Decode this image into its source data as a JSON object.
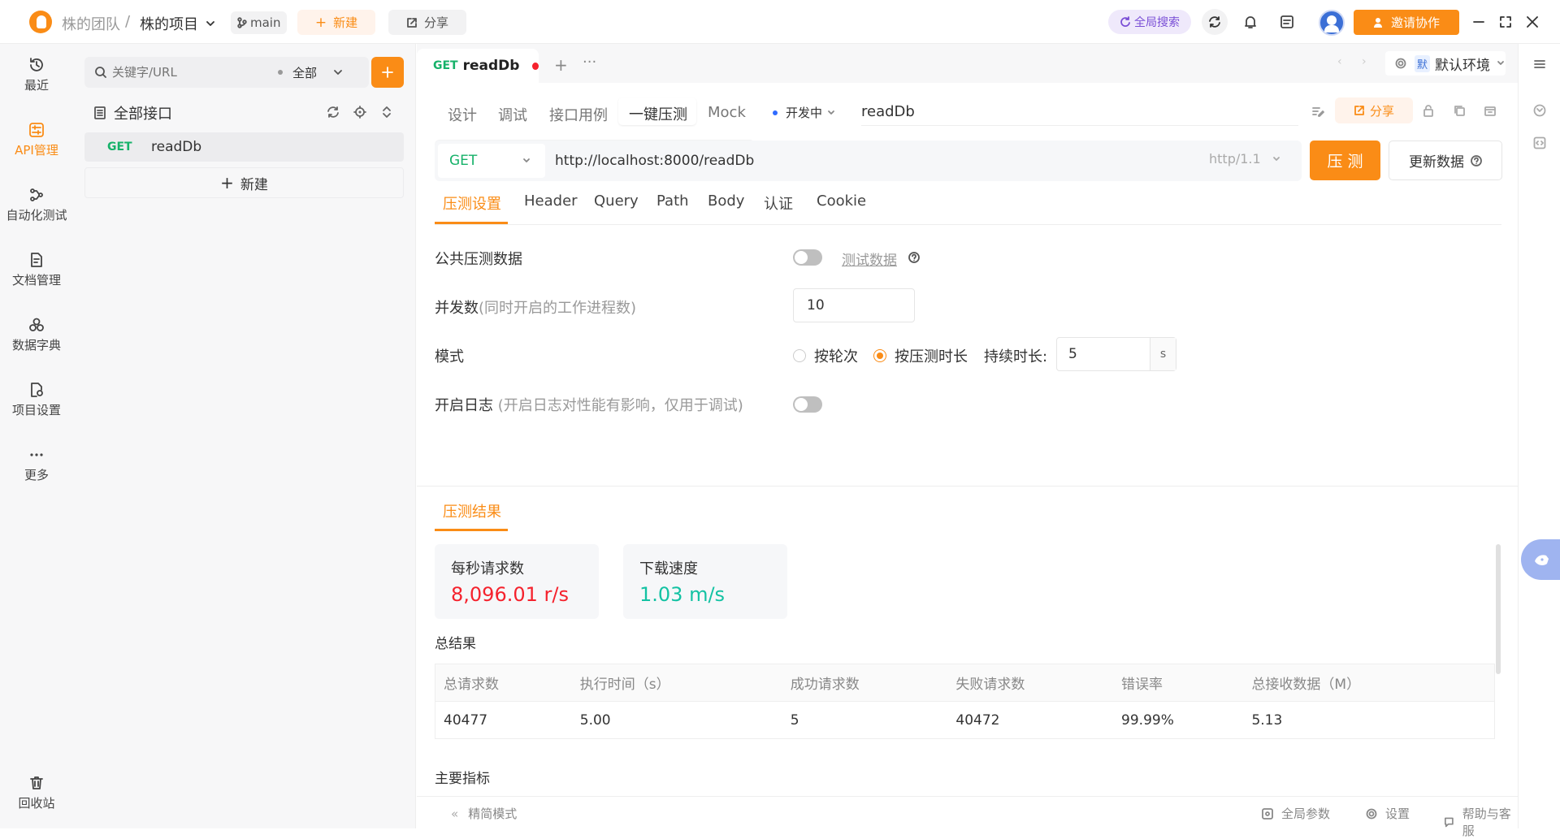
{
  "titlebar": {
    "team": "株的团队",
    "separator": "/",
    "project": "株的项目",
    "branch": "main",
    "new_label": "新建",
    "share_label": "分享",
    "global_search": "全局搜索",
    "invite_label": "邀请协作"
  },
  "nav": [
    {
      "label": "最近",
      "icon": "clock-icon"
    },
    {
      "label": "API管理",
      "icon": "api-icon",
      "active": true
    },
    {
      "label": "自动化测试",
      "icon": "flow-icon"
    },
    {
      "label": "文档管理",
      "icon": "doc-icon"
    },
    {
      "label": "数据字典",
      "icon": "dict-icon"
    },
    {
      "label": "项目设置",
      "icon": "settings-icon"
    },
    {
      "label": "更多",
      "icon": "more-icon"
    },
    {
      "label": "回收站",
      "icon": "trash-icon"
    }
  ],
  "sidebar": {
    "search_placeholder": "关键字/URL",
    "filter": "全部",
    "tree_root": "全部接口",
    "item_method": "GET",
    "item_name": "readDb",
    "new_label": "新建"
  },
  "tabbar": {
    "method": "GET",
    "name": "readDb",
    "env_badge": "默",
    "env": "默认环境"
  },
  "subtabs": [
    "设计",
    "调试",
    "接口用例",
    "一键压测",
    "Mock"
  ],
  "subtab_active": "一键压测",
  "status": "开发中",
  "api_name": "readDb",
  "share_label": "分享",
  "request": {
    "method": "GET",
    "url": "http://localhost:8000/readDb",
    "protocol": "http/1.1",
    "run_label": "压 测",
    "update_label": "更新数据"
  },
  "param_tabs": [
    "压测设置",
    "Header",
    "Query",
    "Path",
    "Body",
    "认证",
    "Cookie"
  ],
  "settings": {
    "public_data_label": "公共压测数据",
    "test_data_link": "测试数据",
    "concurrency_label": "并发数",
    "concurrency_hint": "(同时开启的工作进程数)",
    "concurrency_value": "10",
    "mode_label": "模式",
    "mode_rounds": "按轮次",
    "mode_duration": "按压测时长",
    "duration_label": "持续时长:",
    "duration_value": "5",
    "duration_unit": "s",
    "log_label": "开启日志",
    "log_hint": "(开启日志对性能有影响，仅用于调试)"
  },
  "results": {
    "tab": "压测结果",
    "rps_label": "每秒请求数",
    "rps_value": "8,096.01 r/s",
    "speed_label": "下载速度",
    "speed_value": "1.03 m/s",
    "total_title": "总结果",
    "columns": [
      "总请求数",
      "执行时间（s）",
      "成功请求数",
      "失败请求数",
      "错误率",
      "总接收数据（M）"
    ],
    "row": [
      "40477",
      "5.00",
      "5",
      "40472",
      "99.99%",
      "5.13"
    ],
    "main_metrics": "主要指标"
  },
  "statusbar": {
    "compact": "精简模式",
    "global_params": "全局参数",
    "settings": "设置",
    "help": "帮助与客服"
  },
  "colors": {
    "accent": "#fa8c16",
    "get": "#17b26a",
    "error": "#f5222d",
    "success": "#13c2a3"
  }
}
